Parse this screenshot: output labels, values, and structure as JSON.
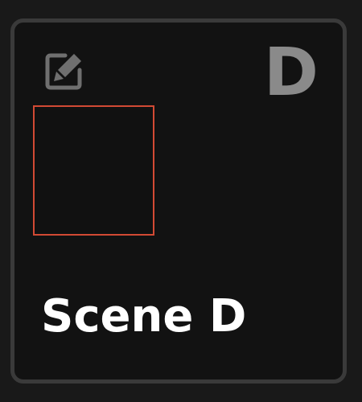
{
  "scene": {
    "letter": "D",
    "title": "Scene D",
    "edit_icon": "edit-icon",
    "preview_border_color": "#d24a34"
  }
}
